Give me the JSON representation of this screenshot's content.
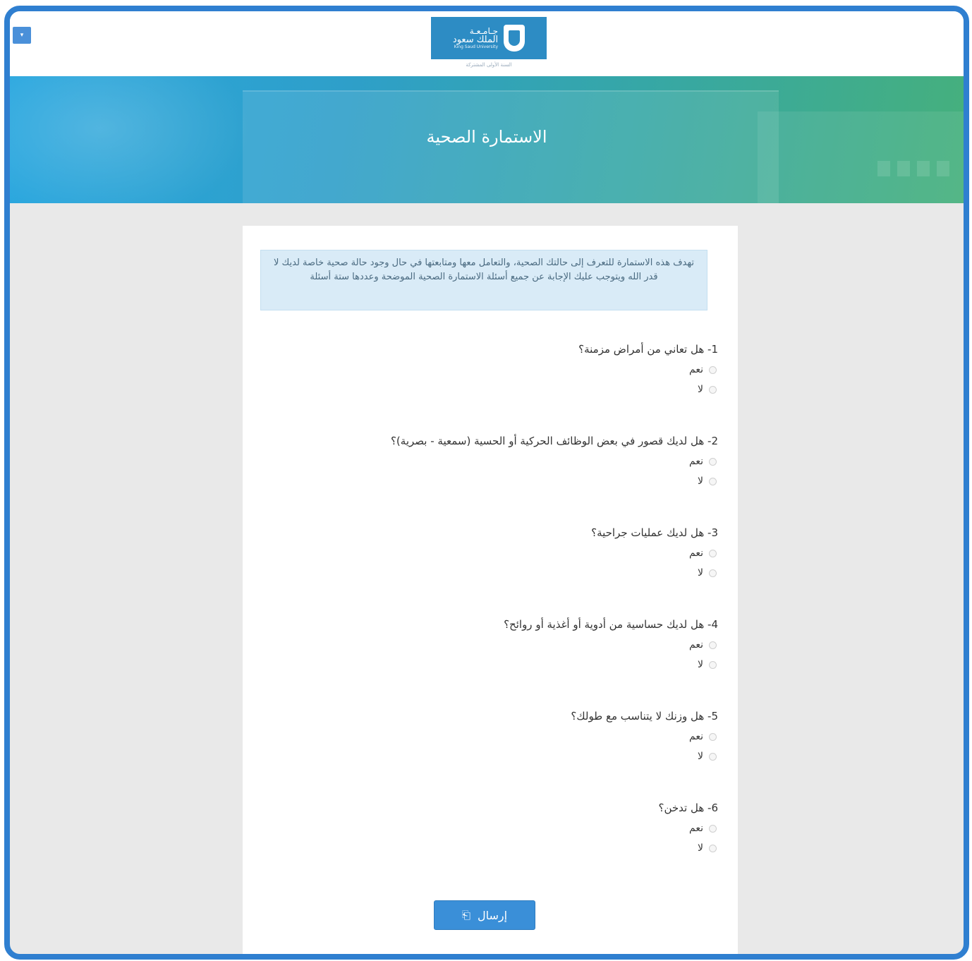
{
  "header": {
    "menu_toggle_glyph": "▾",
    "logo": {
      "line1": "جـامـعـة",
      "line2": "الملك سعود",
      "line3": "King Saud University",
      "caption": "السنة الأولى المشتركة"
    }
  },
  "banner": {
    "title": "الاستمارة الصحية"
  },
  "form": {
    "notice": "تهدف هذه الاستمارة للتعرف إلى حالتك الصحية، والتعامل معها ومتابعتها في حال وجود حالة صحية خاصة لديك لا قدر الله  ويتوجب عليك الإجابة عن جميع أسئلة الاستمارة الصحية الموضحة وعددها ستة أسئلة",
    "questions": [
      {
        "title": "1- هل تعاني من أمراض مزمنة؟",
        "yes": "نعم",
        "no": "لا"
      },
      {
        "title": "2- هل لديك قصور في بعض الوظائف الحركية أو الحسية (سمعية - بصرية)؟",
        "yes": "نعم",
        "no": "لا"
      },
      {
        "title": "3- هل لديك عمليات جراحية؟",
        "yes": "نعم",
        "no": "لا"
      },
      {
        "title": "4- هل لديك حساسية من أدوية أو أغذية أو روائح؟",
        "yes": "نعم",
        "no": "لا"
      },
      {
        "title": "5- هل وزنك لا يتناسب مع طولك؟",
        "yes": "نعم",
        "no": "لا"
      },
      {
        "title": "6- هل تدخن؟",
        "yes": "نعم",
        "no": "لا"
      }
    ],
    "submit_label": "إرسال",
    "submit_icon": "share-icon"
  },
  "colors": {
    "frame": "#2f7fd0",
    "button": "#3a8fd8",
    "notice_bg": "#d9ebf7"
  }
}
